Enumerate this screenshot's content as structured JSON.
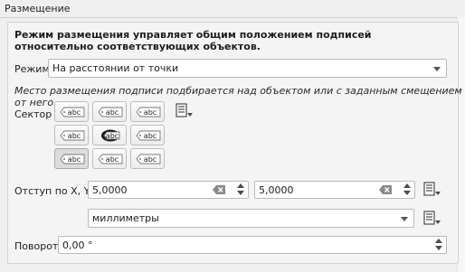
{
  "group": {
    "title": "Размещение"
  },
  "description": "Режим размещения управляет общим положением подписей относительно соответствующих объектов.",
  "mode": {
    "label": "Режим",
    "value": "На расстоянии от точки"
  },
  "hint": "Место размещения подписи подбирается над объектом или с заданным смещением от него.",
  "quadrant": {
    "label": "Сектор",
    "button_text": "abc",
    "selected": "bottom-left",
    "buttons": [
      "top-left",
      "top",
      "top-right",
      "left",
      "over",
      "right",
      "bottom-left",
      "bottom",
      "bottom-right"
    ]
  },
  "offset": {
    "label": "Отступ по X, Y",
    "x": "5,0000",
    "y": "5,0000"
  },
  "units": {
    "value": "миллиметры"
  },
  "rotation": {
    "label": "Поворот",
    "value": "0,00 °"
  },
  "icons": {
    "data_defined": "data-defined-override-icon",
    "clear": "clear-icon"
  }
}
